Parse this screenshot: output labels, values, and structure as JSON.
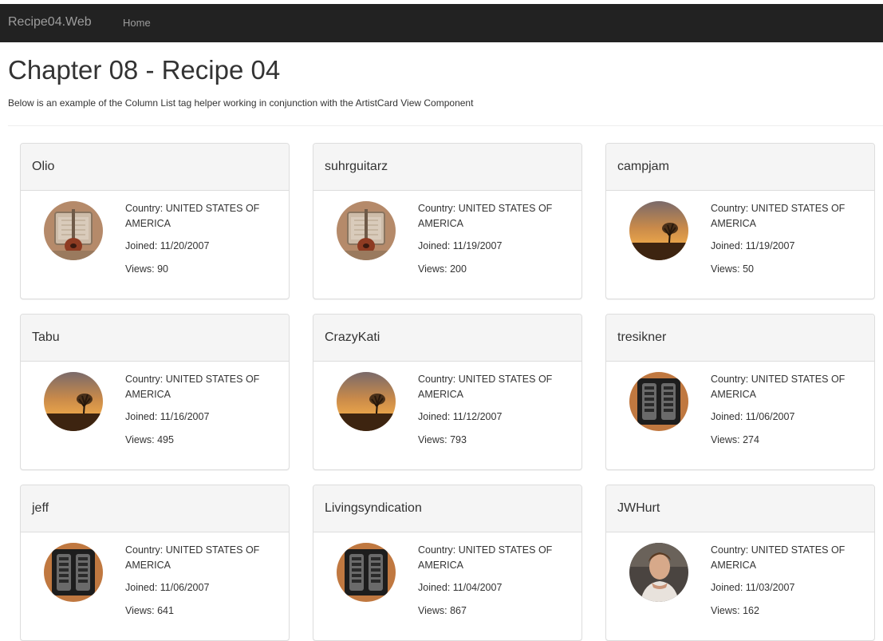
{
  "navbar": {
    "brand": "Recipe04.Web",
    "home_label": "Home"
  },
  "page": {
    "title": "Chapter 08 - Recipe 04",
    "description": "Below is an example of the Column List tag helper working in conjunction with the ArtistCard View Component"
  },
  "colors": {
    "navbar_bg": "#222222",
    "nav_text": "#9d9d9d",
    "panel_heading_bg": "#f5f5f5",
    "panel_border": "#dddddd"
  },
  "artists": [
    {
      "name": "Olio",
      "country": "Country: UNITED STATES OF AMERICA",
      "joined": "Joined: 11/20/2007",
      "views": "Views: 90",
      "avatar": "amp-guitar-icon"
    },
    {
      "name": "suhrguitarz",
      "country": "Country: UNITED STATES OF AMERICA",
      "joined": "Joined: 11/19/2007",
      "views": "Views: 200",
      "avatar": "amp-guitar-icon"
    },
    {
      "name": "campjam",
      "country": "Country: UNITED STATES OF AMERICA",
      "joined": "Joined: 11/19/2007",
      "views": "Views: 50",
      "avatar": "sunset-tree-icon"
    },
    {
      "name": "Tabu",
      "country": "Country: UNITED STATES OF AMERICA",
      "joined": "Joined: 11/16/2007",
      "views": "Views: 495",
      "avatar": "sunset-tree-icon"
    },
    {
      "name": "CrazyKati",
      "country": "Country: UNITED STATES OF AMERICA",
      "joined": "Joined: 11/12/2007",
      "views": "Views: 793",
      "avatar": "sunset-tree-icon"
    },
    {
      "name": "tresikner",
      "country": "Country: UNITED STATES OF AMERICA",
      "joined": "Joined: 11/06/2007",
      "views": "Views: 274",
      "avatar": "pickup-icon"
    },
    {
      "name": "jeff",
      "country": "Country: UNITED STATES OF AMERICA",
      "joined": "Joined: 11/06/2007",
      "views": "Views: 641",
      "avatar": "pickup-icon"
    },
    {
      "name": "Livingsyndication",
      "country": "Country: UNITED STATES OF AMERICA",
      "joined": "Joined: 11/04/2007",
      "views": "Views: 867",
      "avatar": "pickup-icon"
    },
    {
      "name": "JWHurt",
      "country": "Country: UNITED STATES OF AMERICA",
      "joined": "Joined: 11/03/2007",
      "views": "Views: 162",
      "avatar": "person-photo-icon"
    }
  ]
}
